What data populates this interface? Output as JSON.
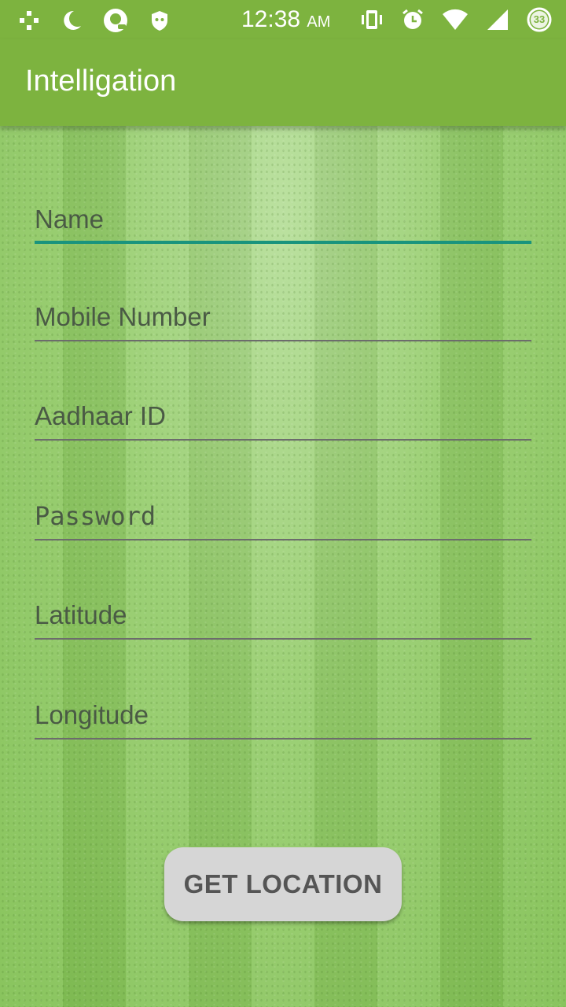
{
  "status_bar": {
    "time": "12:38",
    "ampm": "AM",
    "battery_level": "33",
    "left_icons": [
      "crosshair-icon",
      "moon-icon",
      "app-icon",
      "shield-icon"
    ],
    "right_icons": [
      "vibrate-icon",
      "alarm-icon",
      "wifi-icon",
      "signal-icon",
      "battery-icon"
    ]
  },
  "app_bar": {
    "title": "Intelligation",
    "color": "#7db33f"
  },
  "form": {
    "name_placeholder": "Name",
    "mobile_placeholder": "Mobile Number",
    "aadhaar_placeholder": "Aadhaar ID",
    "password_placeholder": "Password",
    "latitude_placeholder": "Latitude",
    "longitude_placeholder": "Longitude",
    "focus_color": "#19947d"
  },
  "actions": {
    "get_location_label": "GET LOCATION"
  }
}
